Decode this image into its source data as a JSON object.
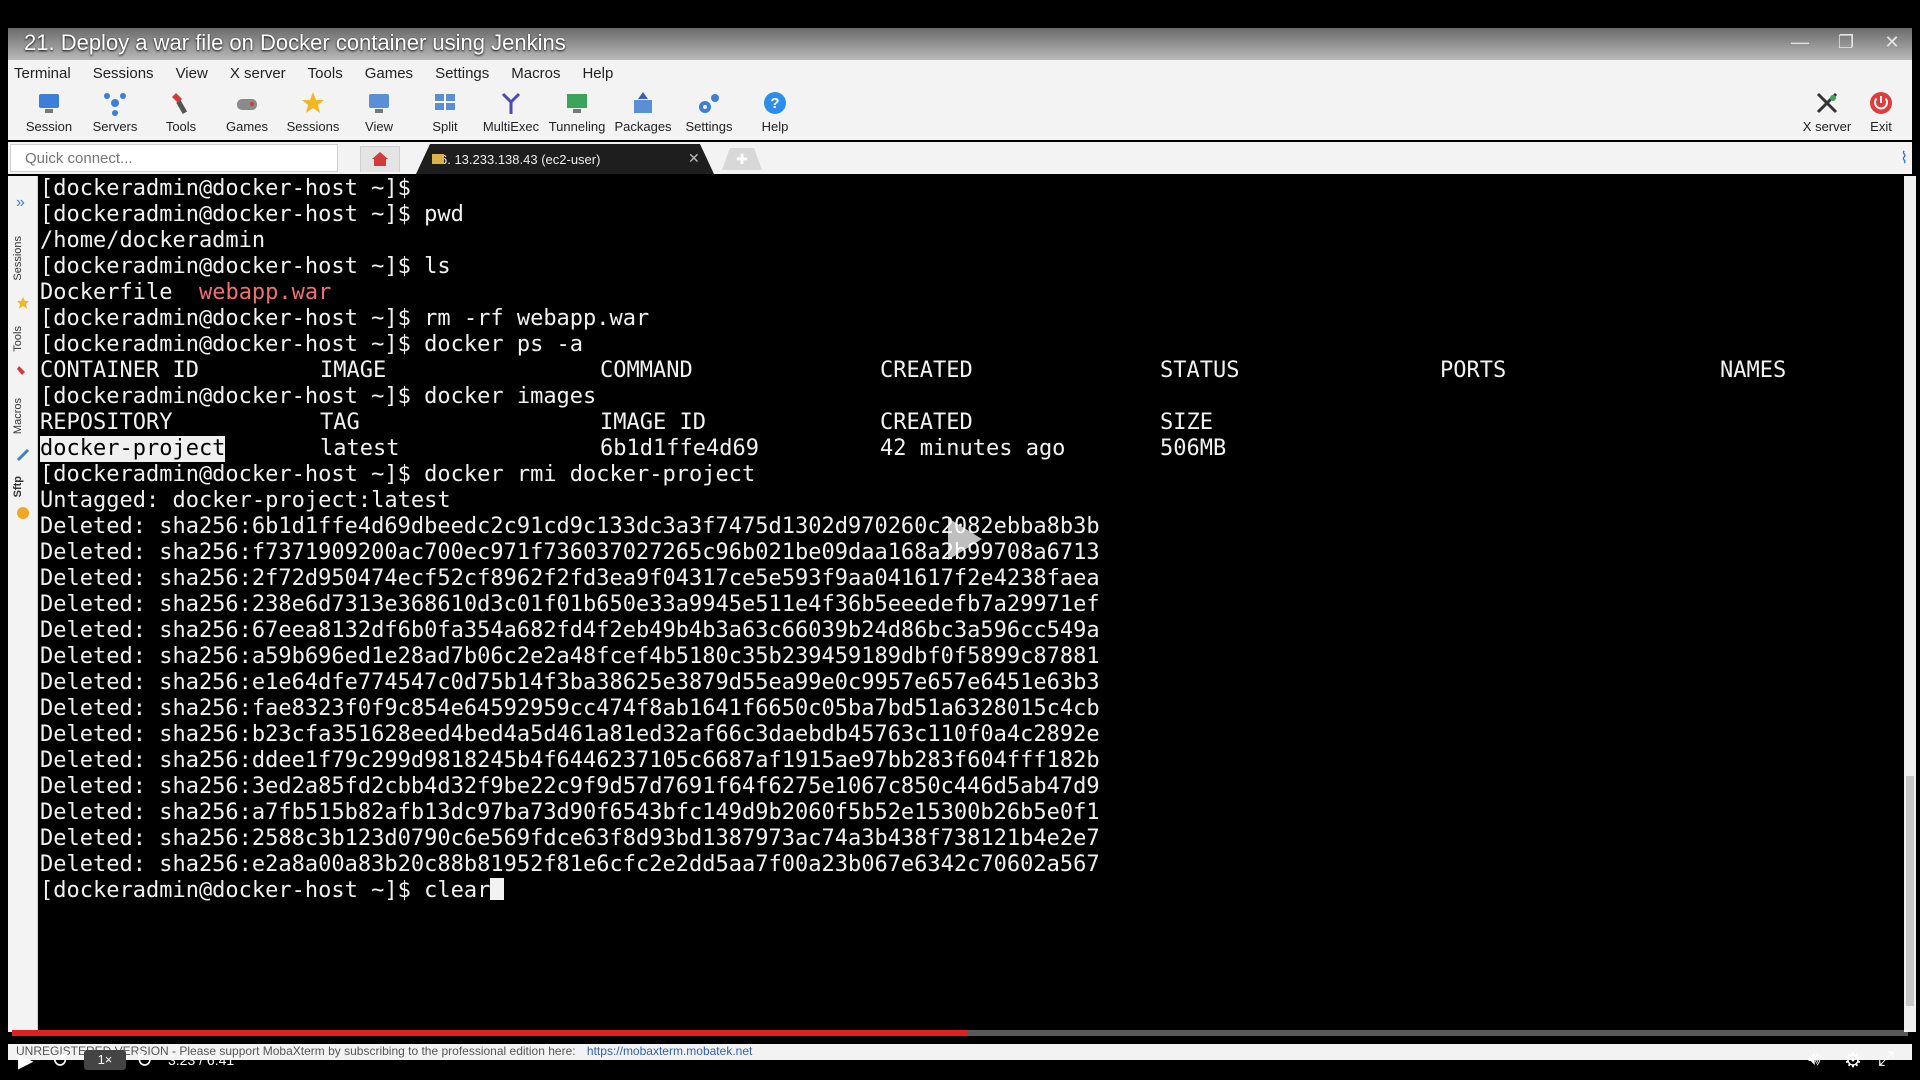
{
  "video": {
    "title": "21. Deploy a war file on Docker container using Jenkins",
    "progress_fraction": 0.504,
    "speed": "1×",
    "time": "3:23 / 6:41"
  },
  "menu": [
    "Terminal",
    "Sessions",
    "View",
    "X server",
    "Tools",
    "Games",
    "Settings",
    "Macros",
    "Help"
  ],
  "toolbar": {
    "items": [
      {
        "label": "Session",
        "icon": "session-icon"
      },
      {
        "label": "Servers",
        "icon": "servers-icon"
      },
      {
        "label": "Tools",
        "icon": "tools-icon"
      },
      {
        "label": "Games",
        "icon": "games-icon"
      },
      {
        "label": "Sessions",
        "icon": "star-icon"
      },
      {
        "label": "View",
        "icon": "view-icon"
      },
      {
        "label": "Split",
        "icon": "split-icon"
      },
      {
        "label": "MultiExec",
        "icon": "multiexec-icon"
      },
      {
        "label": "Tunneling",
        "icon": "tunneling-icon"
      },
      {
        "label": "Packages",
        "icon": "packages-icon"
      },
      {
        "label": "Settings",
        "icon": "settings-icon"
      },
      {
        "label": "Help",
        "icon": "help-icon"
      }
    ],
    "right_items": [
      {
        "label": "X server",
        "icon": "x-server-icon"
      },
      {
        "label": "Exit",
        "icon": "power-icon"
      }
    ]
  },
  "tabs": {
    "quick_connect_placeholder": "Quick connect...",
    "session_tab_label": "6. 13.233.138.43 (ec2-user)"
  },
  "sidepanel": {
    "labels": [
      "Sessions",
      "Tools",
      "Macros",
      "Sftp"
    ]
  },
  "terminal": {
    "lines": [
      "[dockeradmin@docker-host ~]$",
      "[dockeradmin@docker-host ~]$ pwd",
      "/home/dockeradmin",
      "[dockeradmin@docker-host ~]$ ls",
      "Dockerfile  ",
      "[dockeradmin@docker-host ~]$ rm -rf webapp.war",
      "[dockeradmin@docker-host ~]$ docker ps -a",
      "",
      "[dockeradmin@docker-host ~]$ docker images",
      "",
      "",
      "[dockeradmin@docker-host ~]$ docker rmi docker-project",
      "Untagged: docker-project:latest",
      "Deleted: sha256:6b1d1ffe4d69dbeedc2c91cd9c133dc3a3f7475d1302d970260c2082ebba8b3b",
      "Deleted: sha256:f7371909200ac700ec971f736037027265c96b021be09daa168a2b99708a6713",
      "Deleted: sha256:2f72d950474ecf52cf8962f2fd3ea9f04317ce5e593f9aa041617f2e4238faea",
      "Deleted: sha256:238e6d7313e368610d3c01f01b650e33a9945e511e4f36b5eeedefb7a29971ef",
      "Deleted: sha256:67eea8132df6b0fa354a682fd4f2eb49b4b3a63c66039b24d86bc3a596cc549a",
      "Deleted: sha256:a59b696ed1e28ad7b06c2e2a48fcef4b5180c35b239459189dbf0f5899c87881",
      "Deleted: sha256:e1e64dfe774547c0d75b14f3ba38625e3879d55ea99e0c9957e657e6451e63b3",
      "Deleted: sha256:fae8323f0f9c854e64592959cc474f8ab1641f6650c05ba7bd51a6328015c4cb",
      "Deleted: sha256:b23cfa351628eed4bed4a5d461a81ed32af66c3daebdb45763c110f0a4c2892e",
      "Deleted: sha256:ddee1f79c299d9818245b4f6446237105c6687af1915ae97bb283f604fff182b",
      "Deleted: sha256:3ed2a85fd2cbb4d32f9be22c9f9d57d7691f64f6275e1067c850c446d5ab47d9",
      "Deleted: sha256:a7fb515b82afb13dc97ba73d90f6543bfc149d9b2060f5b52e15300b26b5e0f1",
      "Deleted: sha256:2588c3b123d0790c6e569fdce63f8d93bd1387973ac74a3b438f738121b4e2e7",
      "Deleted: sha256:e2a8a00a83b20c88b81952f81e6cfc2e2dd5aa7f00a23b067e6342c70602a567",
      "[dockeradmin@docker-host ~]$ clear"
    ],
    "ls_war_file": "webapp.war",
    "ps_headers": [
      "CONTAINER ID",
      "IMAGE",
      "COMMAND",
      "CREATED",
      "STATUS",
      "PORTS",
      "NAMES"
    ],
    "images_headers": [
      "REPOSITORY",
      "TAG",
      "IMAGE ID",
      "CREATED",
      "SIZE"
    ],
    "images_row": {
      "repository": "docker-project",
      "tag": "latest",
      "image_id": "6b1d1ffe4d69",
      "created": "42 minutes ago",
      "size": "506MB"
    }
  },
  "statusbar": {
    "text": "UNREGISTERED VERSION  -  Please support MobaXterm by subscribing to the professional edition here:",
    "link": "https://mobaxterm.mobatek.net"
  },
  "colors": {
    "war_file": "#f07070",
    "progress": "#e02020"
  }
}
